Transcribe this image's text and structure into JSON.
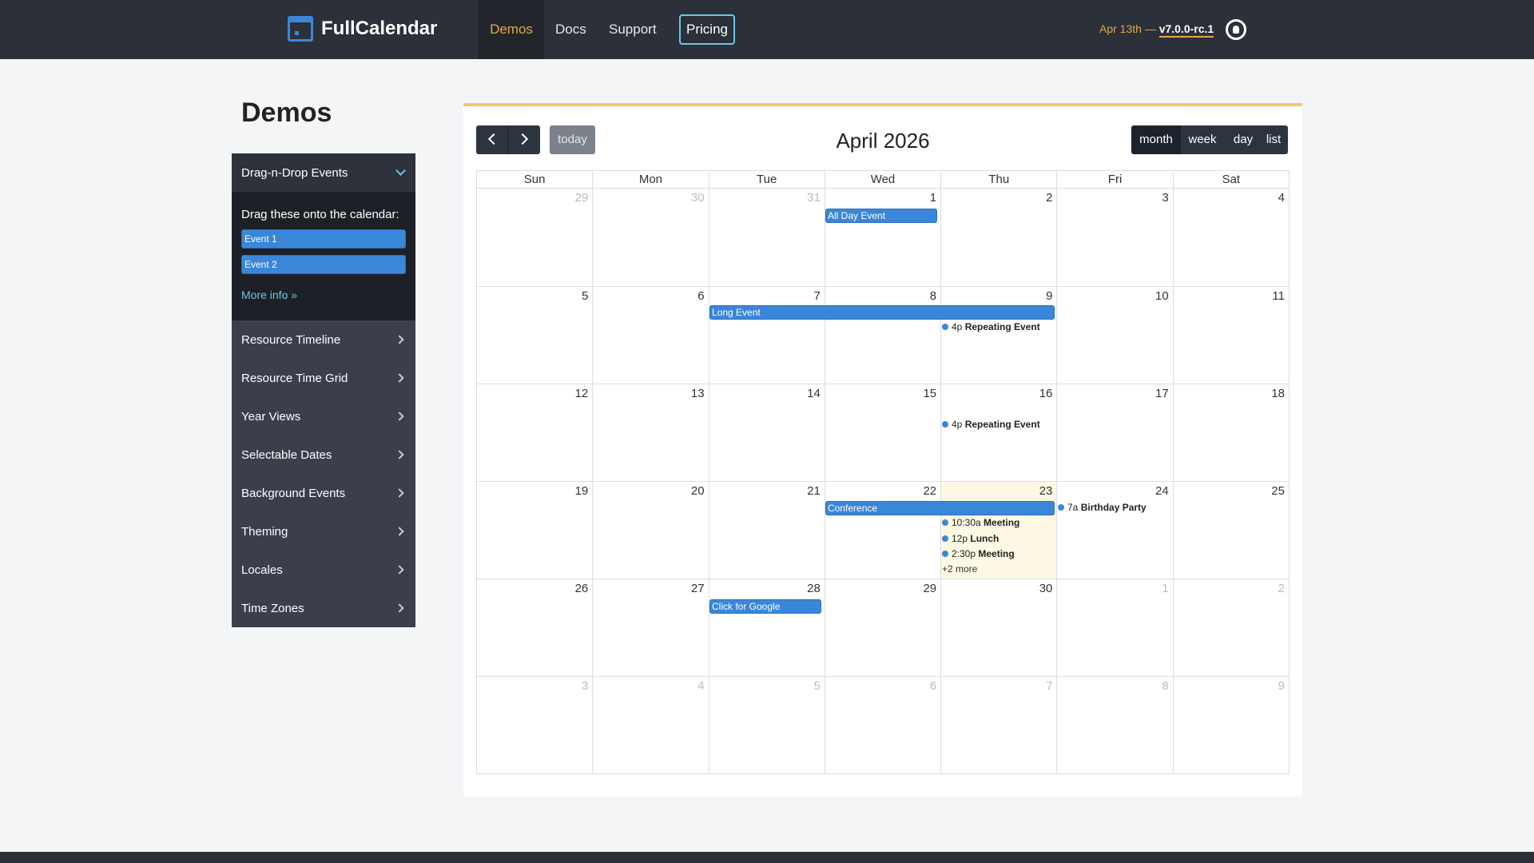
{
  "nav": {
    "brand": "FullCalendar",
    "items": [
      "Demos",
      "Docs",
      "Support"
    ],
    "pricing": "Pricing",
    "release_date": "Apr 13th — ",
    "release_version": "v7.0.0-rc.1"
  },
  "page_title": "Demos",
  "sidebar": {
    "open_section": "Drag-n-Drop Events",
    "drag_title": "Drag these onto the calendar:",
    "drag_events": [
      "Event 1",
      "Event 2"
    ],
    "more_info": "More info »",
    "items": [
      "Resource Timeline",
      "Resource Time Grid",
      "Year Views",
      "Selectable Dates",
      "Background Events",
      "Theming",
      "Locales",
      "Time Zones"
    ]
  },
  "calendar": {
    "title": "April 2026",
    "today_label": "today",
    "views": [
      "month",
      "week",
      "day",
      "list"
    ],
    "active_view": "month",
    "dow": [
      "Sun",
      "Mon",
      "Tue",
      "Wed",
      "Thu",
      "Fri",
      "Sat"
    ],
    "weeks": [
      [
        "29",
        "30",
        "31",
        "1",
        "2",
        "3",
        "4"
      ],
      [
        "5",
        "6",
        "7",
        "8",
        "9",
        "10",
        "11"
      ],
      [
        "12",
        "13",
        "14",
        "15",
        "16",
        "17",
        "18"
      ],
      [
        "19",
        "20",
        "21",
        "22",
        "23",
        "24",
        "25"
      ],
      [
        "26",
        "27",
        "28",
        "29",
        "30",
        "1",
        "2"
      ],
      [
        "3",
        "4",
        "5",
        "6",
        "7",
        "8",
        "9"
      ]
    ],
    "events": {
      "all_day": "All Day Event",
      "long": "Long Event",
      "repeat1_time": "4p",
      "repeat1_title": "Repeating Event",
      "repeat2_time": "4p",
      "repeat2_title": "Repeating Event",
      "conference": "Conference",
      "meeting1_time": "10:30a",
      "meeting1_title": "Meeting",
      "lunch_time": "12p",
      "lunch_title": "Lunch",
      "meeting2_time": "2:30p",
      "meeting2_title": "Meeting",
      "more": "+2 more",
      "birthday_time": "7a",
      "birthday_title": "Birthday Party",
      "google": "Click for Google"
    }
  }
}
